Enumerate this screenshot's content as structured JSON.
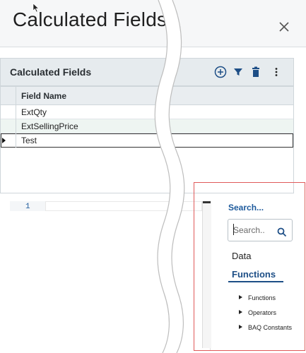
{
  "page": {
    "title": "Calculated Fields"
  },
  "panel": {
    "title": "Calculated Fields",
    "toolbar": {
      "add_icon": "add-circle-icon",
      "filter_icon": "filter-icon",
      "delete_icon": "trash-icon",
      "more_icon": "more-vertical-icon"
    }
  },
  "grid": {
    "column_header": "Field Name",
    "rows": [
      {
        "label": "ExtQty"
      },
      {
        "label": "ExtSellingPrice"
      },
      {
        "label": "Test"
      }
    ]
  },
  "editor": {
    "line_number": "1"
  },
  "side": {
    "search_link": "Search...",
    "search_placeholder": "Search..",
    "tabs": [
      {
        "label": "Data"
      },
      {
        "label": "Functions"
      }
    ],
    "tree": [
      {
        "label": "Functions"
      },
      {
        "label": "Operators"
      },
      {
        "label": "BAQ Constants"
      }
    ]
  },
  "colors": {
    "accent": "#1d4e86",
    "highlight": "#e05a5a",
    "panel_header_bg": "#e6ebee"
  }
}
